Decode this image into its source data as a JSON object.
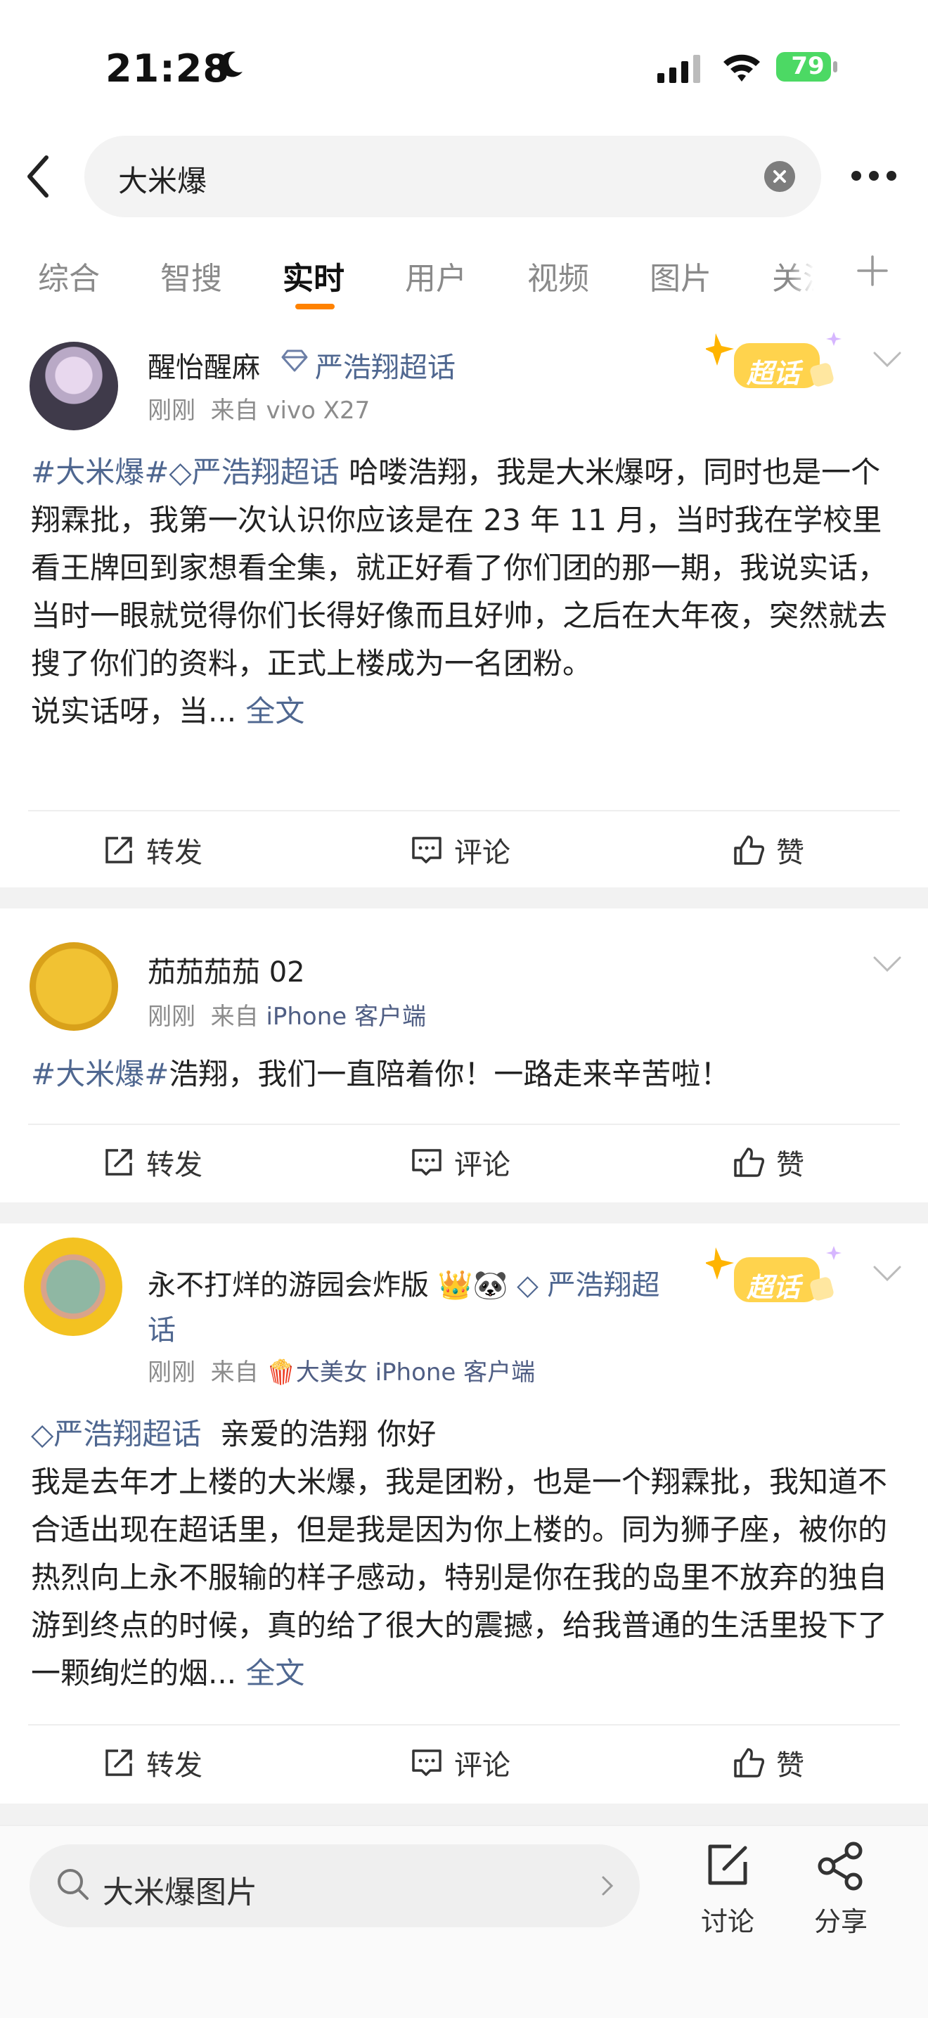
{
  "status_bar": {
    "time": "21:28",
    "battery": "79"
  },
  "search": {
    "query": "大米爆"
  },
  "tabs": [
    "综合",
    "智搜",
    "实时",
    "用户",
    "视频",
    "图片",
    "关注"
  ],
  "active_tab": "实时",
  "posts": [
    {
      "user": "醒怡醒麻",
      "topic_badge": "严浩翔超话",
      "time": "刚刚",
      "via_prefix": "来自",
      "source": "vivo X27",
      "super_badge": "超话",
      "tag1": "#大米爆#",
      "tag2": "严浩翔超话",
      "text": " 哈喽浩翔，我是大米爆呀，同时也是一个翔霖批，我第一次认识你应该是在 23 年 11 月，当时我在学校里看王牌回到家想看全集，就正好看了你们团的那一期，我说实话，当时一眼就觉得你们长得好像而且好帅，之后在大年夜，突然就去搜了你们的资料，正式上楼成为一名团粉。",
      "text2": "说实话呀，当...",
      "more": "全文"
    },
    {
      "user": "茄茄茄茄 02",
      "time": "刚刚",
      "via_prefix": "来自",
      "source": "iPhone 客户端",
      "tag1": "#大米爆#",
      "text": "浩翔，我们一直陪着你！一路走来辛苦啦！"
    },
    {
      "user": "永不打烊的游园会炸版",
      "topic_badge": "严浩翔超话",
      "time": "刚刚",
      "via_prefix": "来自",
      "source": "大美女 iPhone 客户端",
      "super_badge": "超话",
      "tag2": "严浩翔超话",
      "text": "亲爱的浩翔 你好",
      "body": "我是去年才上楼的大米爆，我是团粉，也是一个翔霖批，我知道不合适出现在超话里，但是我是因为你上楼的。同为狮子座，被你的热烈向上永不服输的样子感动，特别是你在我的岛里不放弃的独自游到终点的时候，真的给了很大的震撼，给我普通的生活里投下了一颗绚烂的烟...",
      "more": "全文"
    }
  ],
  "actions": {
    "repost": "转发",
    "comment": "评论",
    "like": "赞"
  },
  "bottom": {
    "search_suggest": "大米爆图片",
    "discuss": "讨论",
    "share": "分享"
  },
  "colors": {
    "accent": "#ff8200",
    "link": "#4f6790",
    "battery": "#4cd964"
  }
}
